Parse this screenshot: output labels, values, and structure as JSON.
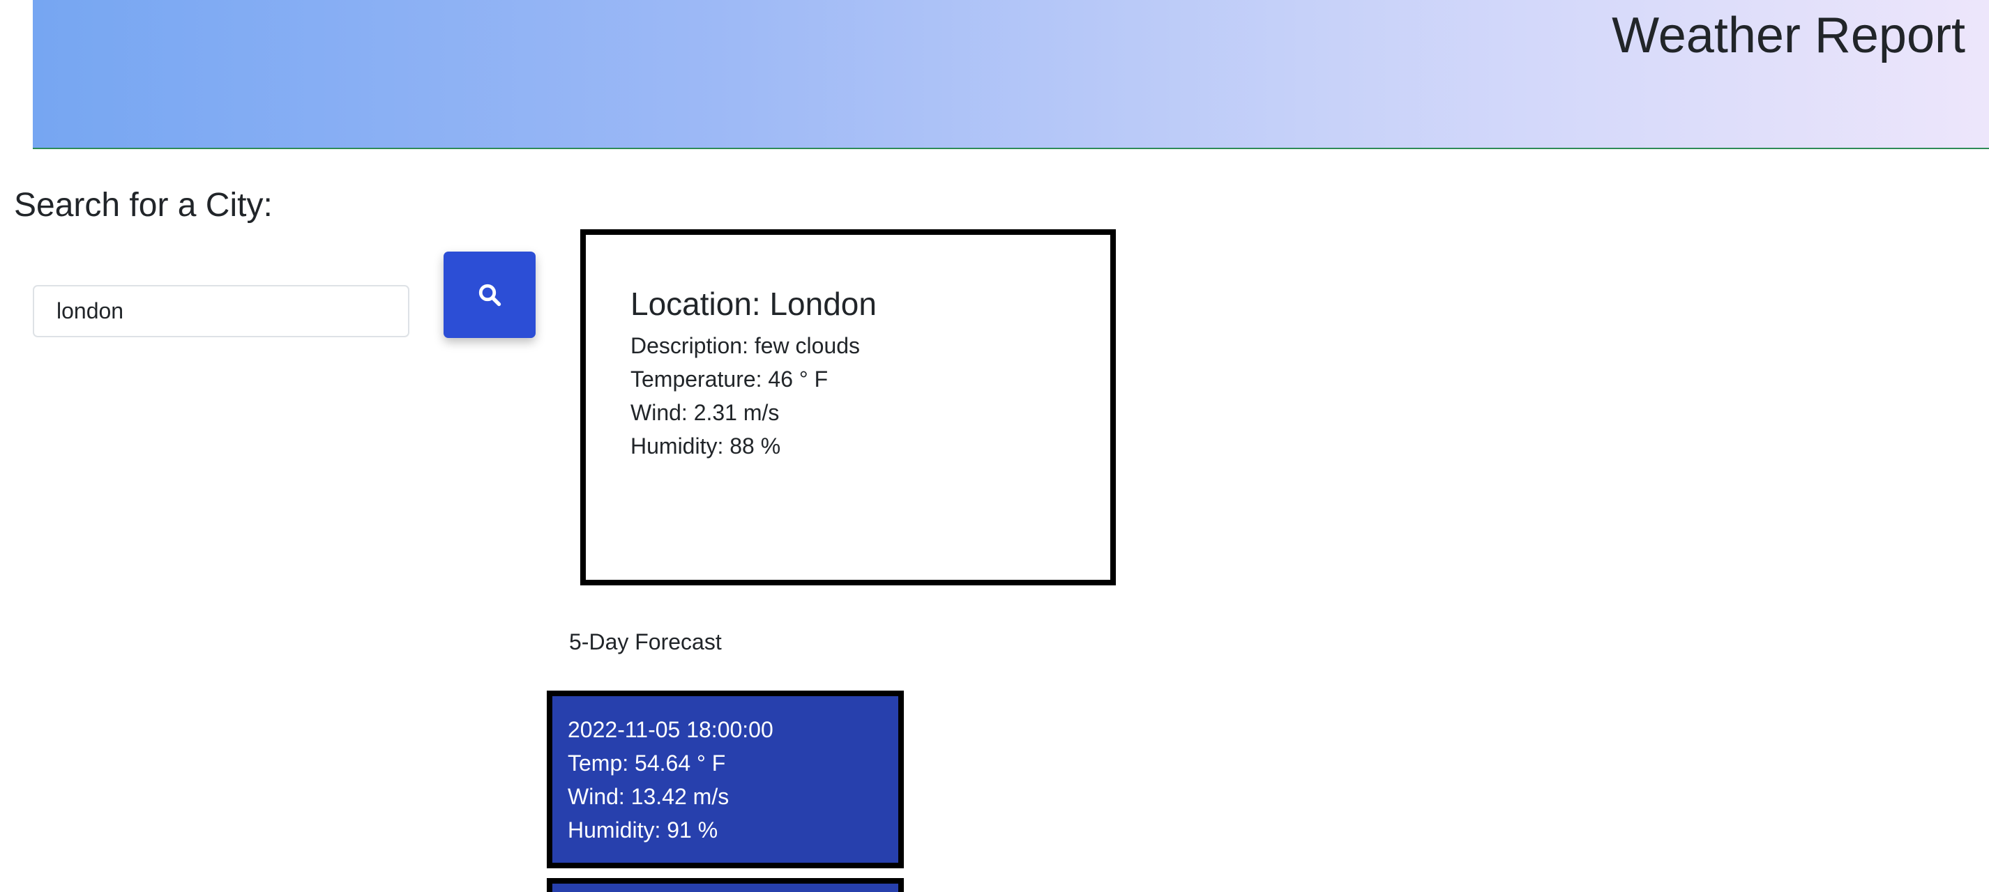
{
  "header": {
    "title": "Weather Report"
  },
  "search": {
    "label": "Search for a City:",
    "input_value": "london",
    "button_icon": "search-icon"
  },
  "current": {
    "location": "Location: London",
    "description": "Description: few clouds",
    "temperature": "Temperature: 46 ° F",
    "wind": "Wind: 2.31 m/s",
    "humidity": "Humidity: 88 %"
  },
  "forecast": {
    "heading": "5-Day Forecast",
    "days": [
      {
        "datetime": "2022-11-05 18:00:00",
        "temp": "Temp: 54.64 ° F",
        "wind": "Wind: 13.42 m/s",
        "humidity": "Humidity: 91 %"
      }
    ]
  },
  "colors": {
    "header_gradient_start": "#76a6f2",
    "header_gradient_end": "#ede6fb",
    "search_button": "#2c4ed6",
    "forecast_card": "#2740ad"
  }
}
